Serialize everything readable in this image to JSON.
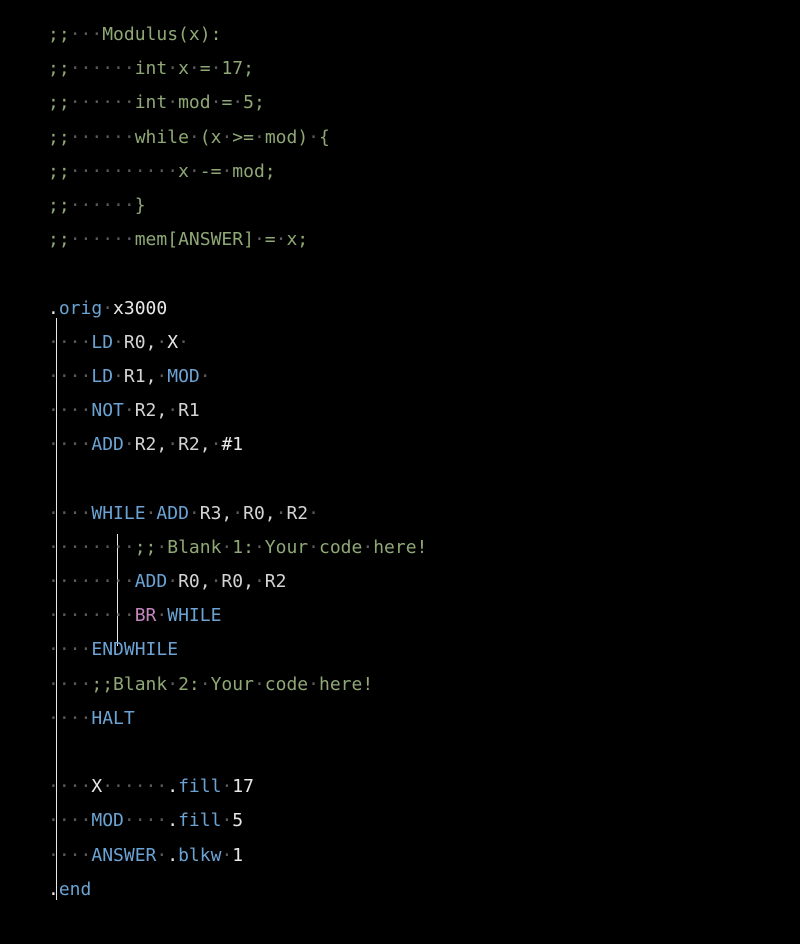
{
  "lines": {
    "l1_pre": ";;",
    "l1_text": "Modulus(x):",
    "l2_pre": ";;",
    "l2_text": "int",
    "l2_b": "x",
    "l2_c": "=",
    "l2_d": "17;",
    "l3_pre": ";;",
    "l3_text": "int",
    "l3_b": "mod",
    "l3_c": "=",
    "l3_d": "5;",
    "l4_pre": ";;",
    "l4_text": "while",
    "l4_b": "(x",
    "l4_c": ">=",
    "l4_d": "mod)",
    "l4_e": "{",
    "l5_pre": ";;",
    "l5_text": "x",
    "l5_b": "-=",
    "l5_c": "mod;",
    "l6_pre": ";;",
    "l6_text": "}",
    "l7_pre": ";;",
    "l7_text": "mem[ANSWER]",
    "l7_b": "=",
    "l7_c": "x;",
    "orig_a": ".",
    "orig_b": "orig",
    "orig_c": "x3000",
    "ld1_op": "LD",
    "ld1_r": "R0,",
    "ld1_x": "X",
    "ld2_op": "LD",
    "ld2_r": "R1,",
    "ld2_m": "MOD",
    "not_op": "NOT",
    "not_r": "R2,",
    "not_r2": "R1",
    "add1_op": "ADD",
    "add1_a": "R2,",
    "add1_b": "R2,",
    "add1_c": "#1",
    "while_lbl": "WHILE",
    "while_op": "ADD",
    "while_a": "R3,",
    "while_b": "R0,",
    "while_c": "R2",
    "blank1_pre": ";;",
    "blank1_text": "Blank",
    "blank1_b": "1:",
    "blank1_c": "Your",
    "blank1_d": "code",
    "blank1_e": "here!",
    "add2_op": "ADD",
    "add2_a": "R0,",
    "add2_b": "R0,",
    "add2_c": "R2",
    "br_op": "BR",
    "br_lbl": "WHILE",
    "endwhile": "ENDWHILE",
    "blank2_pre": ";;Blank",
    "blank2_b": "2:",
    "blank2_c": "Your",
    "blank2_d": "code",
    "blank2_e": "here!",
    "halt": "HALT",
    "x_lbl": "X",
    "x_dir": "fill",
    "x_val": "17",
    "mod_lbl": "MOD",
    "mod_dir": "fill",
    "mod_val": "5",
    "ans_lbl": "ANSWER",
    "ans_dir": "blkw",
    "ans_val": "1",
    "end_a": ".",
    "end_b": "end"
  }
}
